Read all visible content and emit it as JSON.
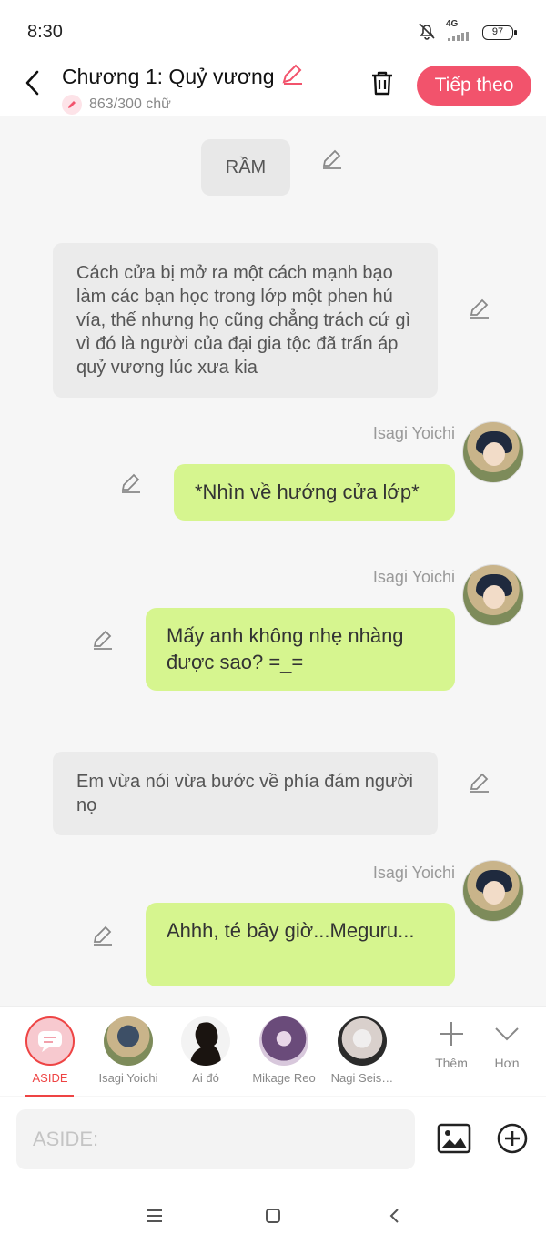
{
  "status": {
    "time": "8:30",
    "network": "4G",
    "battery": "97"
  },
  "header": {
    "title": "Chương 1: Quỷ vương",
    "word_count": "863/300 chữ",
    "next_label": "Tiếp theo"
  },
  "feed": {
    "sfx": "RẦM",
    "narration_1": "Cách cửa bị mở ra một cách mạnh bạo làm các bạn học trong lớp một phen hú vía, thế nhưng họ cũng chẳng trách cứ gì vì đó là người của đại gia tộc đã trấn áp quỷ vương lúc xưa kia",
    "speaker_1": "Isagi Yoichi",
    "message_1": "*Nhìn về hướng cửa lớp*",
    "speaker_2": "Isagi Yoichi",
    "message_2": "Mấy anh không nhẹ nhàng được sao? =_=",
    "narration_2": "Em vừa nói vừa bước về phía đám người nọ",
    "speaker_3": "Isagi Yoichi",
    "message_3": "Ahhh, té bây giờ...Meguru..."
  },
  "characters": [
    {
      "name": "ASIDE"
    },
    {
      "name": "Isagi Yoichi"
    },
    {
      "name": "Ai đó"
    },
    {
      "name": "Mikage Reo"
    },
    {
      "name": "Nagi Seis…"
    }
  ],
  "actions": {
    "more_label": "Thêm",
    "collapse_label": "Hơn"
  },
  "input": {
    "placeholder": "ASIDE:"
  },
  "colors": {
    "accent": "#f2536c",
    "bubble": "#d6f58f",
    "narration": "#ebebeb"
  }
}
